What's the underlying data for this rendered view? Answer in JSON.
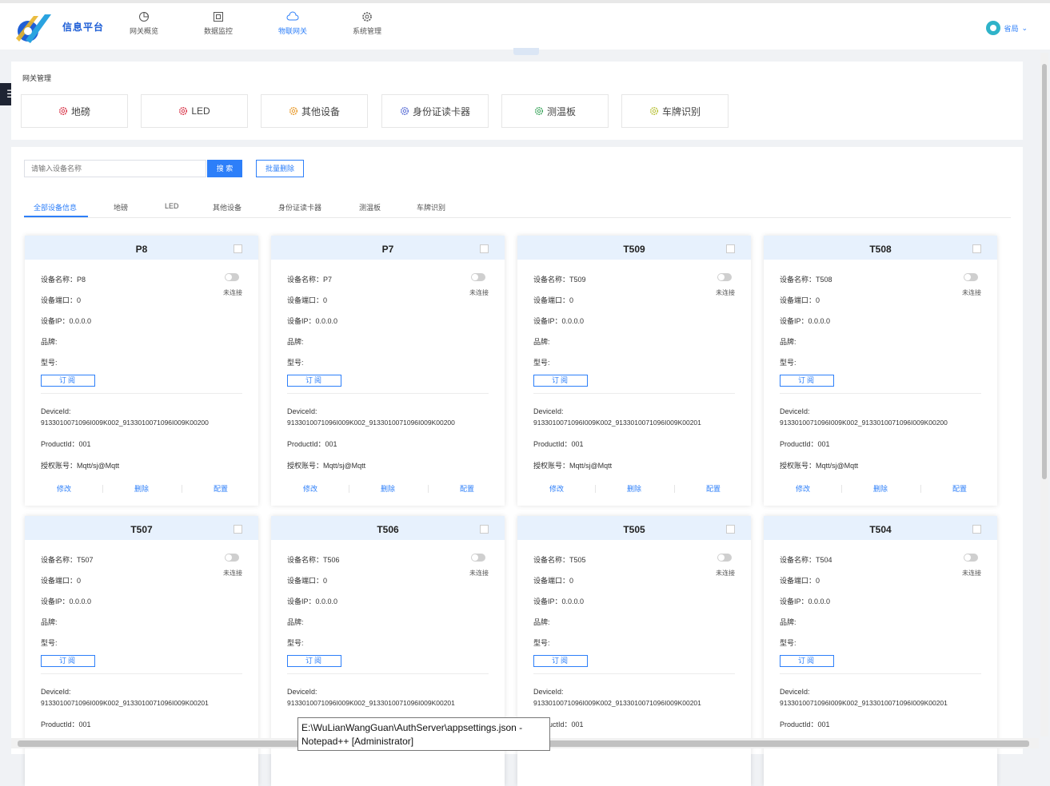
{
  "brand": "信息平台",
  "nav": [
    "网关概览",
    "数据监控",
    "物联网关",
    "系统管理"
  ],
  "user": "省局",
  "breadcrumb": "网关管理",
  "categories": [
    "地磅",
    "LED",
    "其他设备",
    "身份证读卡器",
    "测温板",
    "车牌识别"
  ],
  "category_colors": [
    "#d9374b",
    "#d9374b",
    "#e89a2c",
    "#5b6fd6",
    "#3ba55c",
    "#b9c23a"
  ],
  "search": {
    "placeholder": "请输入设备名称",
    "button": "搜 索"
  },
  "batch_delete": "批量删除",
  "tabs": [
    "全部设备信息",
    "地磅",
    "LED",
    "其他设备",
    "身份证读卡器",
    "测温板",
    "车牌识别"
  ],
  "labels": {
    "name": "设备名称：",
    "port": "设备端口：",
    "ip": "设备IP：",
    "brandf": "品牌:",
    "model": "型号:",
    "subscribe": "订阅",
    "deviceid": "DeviceId:",
    "productid": "ProductId：",
    "account": "授权账号：",
    "status": "未连接",
    "edit": "修改",
    "delete": "删除",
    "config": "配置"
  },
  "cards": [
    {
      "title": "P8",
      "name": "P8",
      "port": "0",
      "ip": "0.0.0.0",
      "deviceid": "9133010071096I009K002_9133010071096I009K00200",
      "productid": "001",
      "account": "Mqtt/sj@Mqtt"
    },
    {
      "title": "P7",
      "name": "P7",
      "port": "0",
      "ip": "0.0.0.0",
      "deviceid": "9133010071096I009K002_9133010071096I009K00200",
      "productid": "001",
      "account": "Mqtt/sj@Mqtt"
    },
    {
      "title": "T509",
      "name": "T509",
      "port": "0",
      "ip": "0.0.0.0",
      "deviceid": "9133010071096I009K002_9133010071096I009K00201",
      "productid": "001",
      "account": "Mqtt/sj@Mqtt"
    },
    {
      "title": "T508",
      "name": "T508",
      "port": "0",
      "ip": "0.0.0.0",
      "deviceid": "9133010071096I009K002_9133010071096I009K00200",
      "productid": "001",
      "account": "Mqtt/sj@Mqtt"
    },
    {
      "title": "T507",
      "name": "T507",
      "port": "0",
      "ip": "0.0.0.0",
      "deviceid": "9133010071096I009K002_9133010071096I009K00201",
      "productid": "001",
      "account": ""
    },
    {
      "title": "T506",
      "name": "T506",
      "port": "0",
      "ip": "0.0.0.0",
      "deviceid": "9133010071096I009K002_9133010071096I009K00201",
      "productid": "",
      "account": ""
    },
    {
      "title": "T505",
      "name": "T505",
      "port": "0",
      "ip": "0.0.0.0",
      "deviceid": "9133010071096I009K002_9133010071096I009K00201",
      "productid": "001",
      "account": ""
    },
    {
      "title": "T504",
      "name": "T504",
      "port": "0",
      "ip": "0.0.0.0",
      "deviceid": "9133010071096I009K002_9133010071096I009K00201",
      "productid": "001",
      "account": ""
    }
  ],
  "tooltip": [
    "E:\\WuLianWangGuan\\AuthServer\\appsettings.json -",
    "Notepad++ [Administrator]"
  ]
}
